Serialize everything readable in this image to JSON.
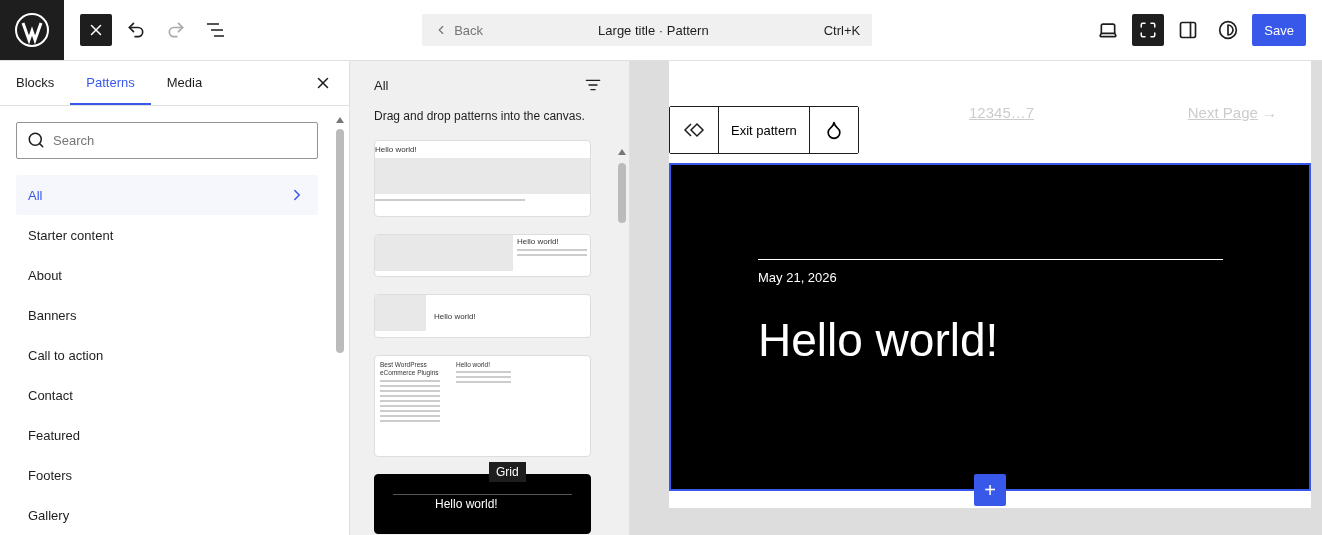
{
  "topbar": {
    "back": "Back",
    "title": "Large title · Pattern",
    "shortcut": "Ctrl+K",
    "save": "Save",
    "view_active": true
  },
  "tabs": [
    {
      "label": "Blocks",
      "selected": false
    },
    {
      "label": "Patterns",
      "selected": true
    },
    {
      "label": "Media",
      "selected": false
    }
  ],
  "search": {
    "placeholder": "Search"
  },
  "categories": [
    {
      "label": "All",
      "selected": true
    },
    {
      "label": "Starter content",
      "selected": false
    },
    {
      "label": "About",
      "selected": false
    },
    {
      "label": "Banners",
      "selected": false
    },
    {
      "label": "Call to action",
      "selected": false
    },
    {
      "label": "Contact",
      "selected": false
    },
    {
      "label": "Featured",
      "selected": false
    },
    {
      "label": "Footers",
      "selected": false
    },
    {
      "label": "Gallery",
      "selected": false
    }
  ],
  "patterns_panel": {
    "filter": "All",
    "hint": "Drag and drop patterns into the canvas.",
    "tooltip": "Grid",
    "previews": [
      {
        "kind": "image-top",
        "title": "Hello world!"
      },
      {
        "kind": "image-left-wide",
        "title": "Hello world!"
      },
      {
        "kind": "image-left-small",
        "title": "Hello world!"
      },
      {
        "kind": "two-column",
        "heading": "Best WordPress eCommerce Plugins",
        "title": "Hello world!"
      },
      {
        "kind": "dark",
        "title": "Hello world!"
      }
    ]
  },
  "canvas": {
    "exit": "Exit pattern",
    "pages": [
      "1",
      "2",
      "3",
      "4",
      "5",
      "…",
      "7"
    ],
    "next": "Next Page",
    "arrow": "→",
    "date": "May 21, 2026",
    "heading": "Hello world!",
    "add": "+"
  }
}
